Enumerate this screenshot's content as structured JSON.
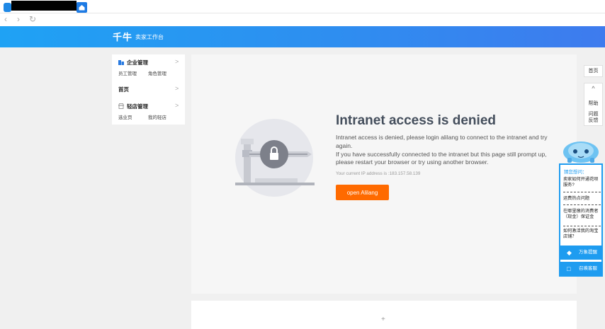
{
  "browser": {
    "back_glyph": "‹",
    "forward_glyph": "›",
    "reload_glyph": "↻",
    "home_icon": "home-icon"
  },
  "header": {
    "logo": "千牛",
    "subtitle": "卖家工作台"
  },
  "sidebar": {
    "sections": [
      {
        "title": "企业管理",
        "icon": "building-icon",
        "items": [
          "员工管理",
          "角色管理"
        ]
      },
      {
        "title": "首页",
        "items": []
      },
      {
        "title": "轻店管理",
        "icon": "shop-icon",
        "items": [
          "选业页",
          "我的轻店"
        ]
      }
    ],
    "arrow": ">"
  },
  "error": {
    "title": "Intranet access is denied",
    "line1": "Intranet access is denied, please login alilang to connect to the intranet and try again.",
    "line2": "If you have successfully connected to the intranet but this page still prompt up, please restart your browser or try using another browser.",
    "ip": "Your current IP address is :183.157.58.139",
    "button": "open Alilang"
  },
  "right_tools": {
    "home": "首页",
    "up_glyph": "^",
    "help": "帮助",
    "feedback_1": "问题",
    "feedback_2": "反馈"
  },
  "assistant": {
    "head": "猜您想问：",
    "questions": [
      "卖家如何开通花呗服务?",
      "运费热点问题",
      "在哪里缴的消费者（现金）保证金",
      "如何激活我的淘宝店铺？"
    ],
    "btn1": "万象提醒",
    "btn2": "召唤客服"
  },
  "lower_card": {
    "plus": "+"
  },
  "colors": {
    "header_start": "#1fa2f4",
    "header_end": "#3e7bee",
    "accent": "#ff6a00",
    "chat": "#1e9cf0"
  }
}
